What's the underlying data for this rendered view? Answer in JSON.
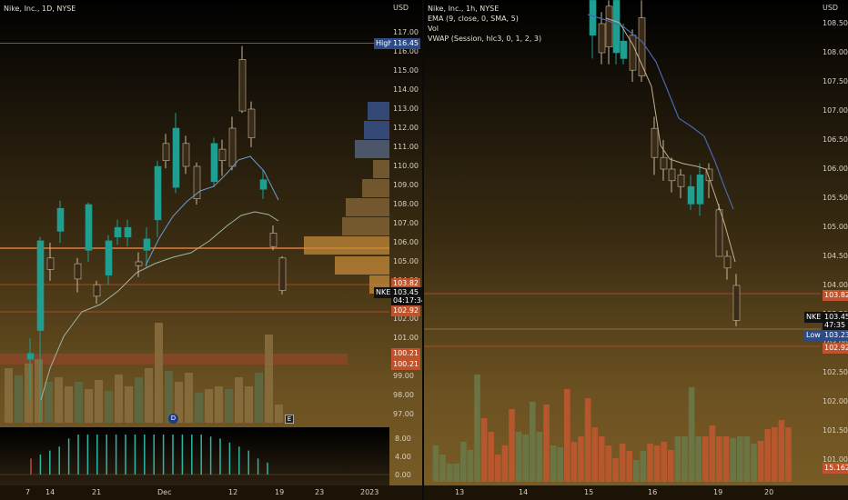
{
  "left": {
    "legend": "Nike, Inc., 1D, NYSE",
    "currency": "USD",
    "price_ticks": [
      "117.00",
      "116.00",
      "115.00",
      "114.00",
      "113.00",
      "112.00",
      "111.00",
      "110.00",
      "109.00",
      "108.00",
      "107.00",
      "106.00",
      "105.00",
      "104.00",
      "103.00",
      "102.00",
      "101.00",
      "100.00",
      "99.00",
      "98.00",
      "97.00"
    ],
    "osc_ticks": [
      "8.00",
      "4.00",
      "0.00"
    ],
    "high_tag": {
      "label": "High",
      "value": "116.45"
    },
    "symbol_tag": {
      "label": "NKE",
      "price": "103.45",
      "countdown": "04:17:34"
    },
    "tags": [
      "103.82",
      "102.92",
      "100.21",
      "100.21"
    ],
    "time_labels": [
      "7",
      "14",
      "21",
      "Dec",
      "12",
      "19",
      "23",
      "2023"
    ],
    "event_icons": [
      "D",
      "E"
    ],
    "colors": {
      "up": "#1f9e91",
      "down": "#ef5350",
      "ema": "#6f9cd6",
      "hline": "#e07b39"
    }
  },
  "right": {
    "legend": [
      "Nike, Inc., 1h, NYSE",
      "EMA (9, close, 0, SMA, 5)",
      "Vol",
      "VWAP (Session, hlc3, 0, 1, 2, 3)"
    ],
    "currency": "USD",
    "price_ticks": [
      "108.50",
      "108.00",
      "107.50",
      "107.00",
      "106.50",
      "106.00",
      "105.50",
      "105.00",
      "104.50",
      "104.00",
      "103.50",
      "103.00",
      "102.50",
      "102.00",
      "101.50",
      "101.00"
    ],
    "symbol_tag": {
      "label": "NKE",
      "price": "103.45",
      "countdown": "47:35"
    },
    "low_tag": {
      "label": "Low",
      "value": "103.23"
    },
    "tags": [
      "103.82",
      "102.92",
      "15.162K"
    ],
    "time_labels": [
      "13",
      "14",
      "15",
      "16",
      "19",
      "20"
    ]
  }
}
